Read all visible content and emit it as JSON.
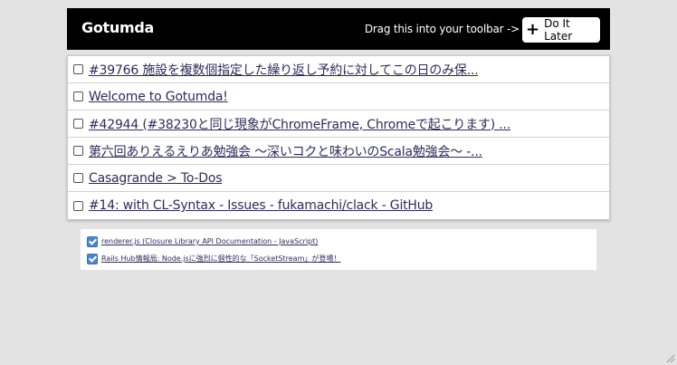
{
  "header": {
    "brand": "Gotumda",
    "drag_hint": "Drag this into your toolbar ->",
    "button_label": "Do It Later",
    "button_icon": "+"
  },
  "tasks": [
    {
      "label": "#39766 施設を複数個指定した繰り返し予約に対してこの日のみ保..."
    },
    {
      "label": "Welcome to Gotumda!"
    },
    {
      "label": "#42944 (#38230と同じ現象がChromeFrame, Chromeで起こります) ..."
    },
    {
      "label": "第六回ありえるえりあ勉強会 〜深いコクと味わいのScala勉強会〜 -..."
    },
    {
      "label": "Casagrande > To-Dos"
    },
    {
      "label": "#14: with CL-Syntax - Issues - fukamachi/clack - GitHub"
    }
  ],
  "done": [
    {
      "label": "renderer.js (Closure Library API Documentation - JavaScript)"
    },
    {
      "label": "Rails Hub情報局: Node.jsに強烈に個性的な「SocketStream」が登場！"
    }
  ]
}
